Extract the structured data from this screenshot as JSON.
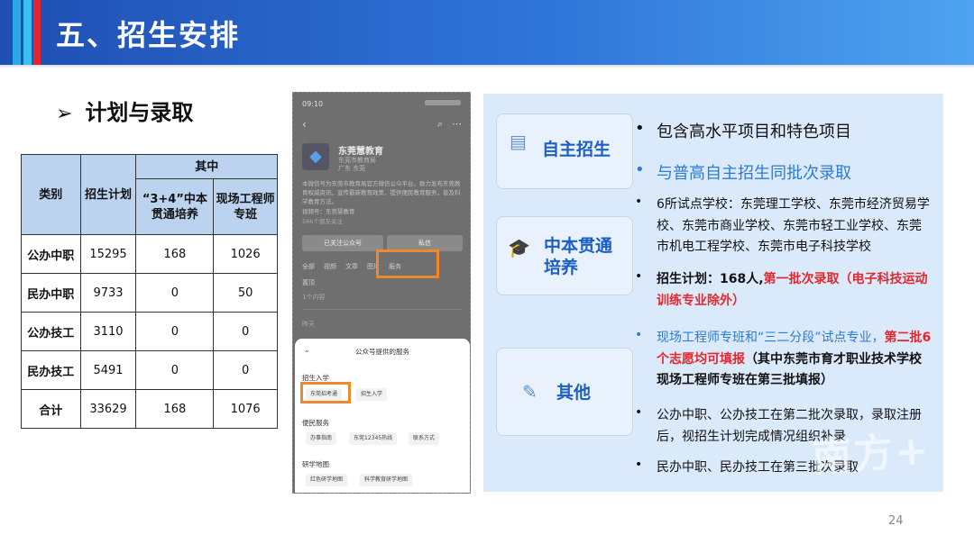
{
  "header": {
    "title": "五、招生安排"
  },
  "section": {
    "arrow": "➢",
    "title": "计划与录取"
  },
  "table": {
    "headers": {
      "category": "类别",
      "plan": "招生计划",
      "among": "其中",
      "sub1": "“3+4”中本贯通培养",
      "sub2": "现场工程师专班"
    },
    "rows": [
      {
        "category": "公办中职",
        "plan": "15295",
        "a": "168",
        "b": "1026"
      },
      {
        "category": "民办中职",
        "plan": "9733",
        "a": "0",
        "b": "50"
      },
      {
        "category": "公办技工",
        "plan": "3110",
        "a": "0",
        "b": "0"
      },
      {
        "category": "民办技工",
        "plan": "5491",
        "a": "0",
        "b": "0"
      },
      {
        "category": "合计",
        "plan": "33629",
        "a": "168",
        "b": "1076"
      }
    ]
  },
  "phone": {
    "time": "09:10",
    "account_name": "东莞慧教育",
    "account_sub1": "东莞市教育局",
    "account_sub2": "广东 东莞",
    "desc": "本微信号为东莞市教育局官方微信公众平台，致力发布东莞教育权威资讯，宣传最新教育政策，提供便民教育服务，普及科学教育方法。",
    "video": "视频号：东莞慧教育",
    "fans": "566个朋友关注",
    "btn_followed": "已关注公众号",
    "btn_message": "私信",
    "tabs": [
      "全部",
      "视频",
      "文章",
      "图片",
      "服务"
    ],
    "pinned": "置顶",
    "dim1": "1个内容",
    "dim2": "昨天",
    "sheet_title": "公众号提供的服务",
    "sec_admission": "招生入学",
    "chip_exam": "东莞招考通",
    "chip_enroll": "招生入学",
    "sec_service": "便民服务",
    "chip_guide": "办事指南",
    "chip_hotline": "东莞12345热线",
    "chip_contact": "联系方式",
    "sec_map": "研学地图",
    "chip_red": "红色研学地图",
    "chip_sci": "科学教育研学地图"
  },
  "cards": {
    "self": "自主招生",
    "through": "中本贯通\n培养",
    "other": "其他"
  },
  "items": {
    "i1": "包含高水平项目和特色项目",
    "i2": "与普高自主招生同批次录取",
    "i3": "6所试点学校：东莞理工学校、东莞市经济贸易学校、东莞市商业学校、东莞市轻工业学校、东莞市机电工程学校、东莞市电子科技学校",
    "i4a": "招生计划：168人,",
    "i4b": "第一批次录取（电子科技运动训练专业除外）",
    "i5a": "现场工程师专班和“三二分段”试点专业，",
    "i5b": "第二批6个志愿均可填报",
    "i5c": "（其中东莞市育才职业技术学校现场工程师专班在第三批填报）",
    "i6": "公办中职、公办技工在第二批次录取，录取注册后，视招生计划完成情况组织补录",
    "i7": "民办中职、民办技工在第三批次录取"
  },
  "page_number": "24",
  "watermark": "南方+"
}
